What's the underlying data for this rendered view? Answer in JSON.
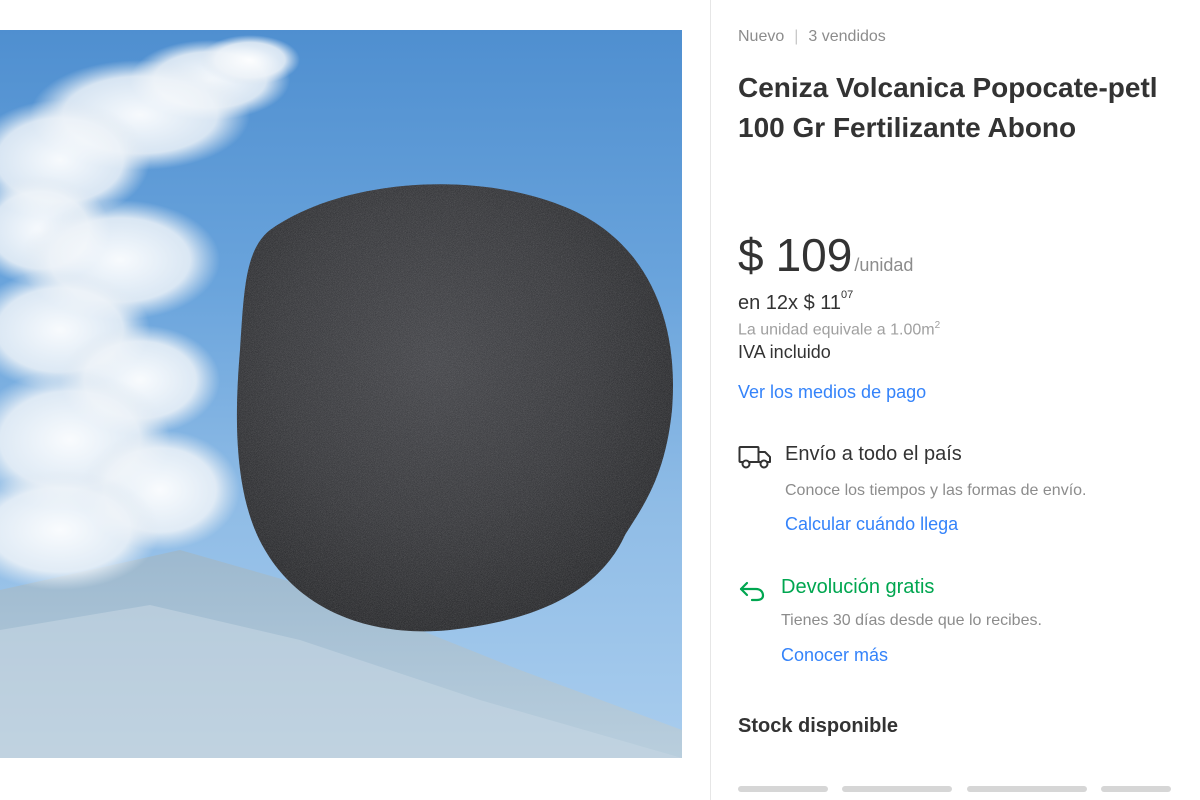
{
  "product": {
    "condition": "Nuevo",
    "separator": "|",
    "sold": "3 vendidos",
    "title": "Ceniza Volcanica Popocate-petl 100 Gr Fertilizante Abono",
    "image_alt": "volcanic-ash-product-photo"
  },
  "price": {
    "symbol": "$",
    "amount": "109",
    "unit": "/unidad",
    "installments_prefix": "en 12x $ 11",
    "installments_cents": "07",
    "equivalence_text": "La unidad equivale a 1.00m",
    "equivalence_sup": "2",
    "tax_note": "IVA incluido",
    "payment_link": "Ver los medios de pago"
  },
  "shipping": {
    "icon": "truck-icon",
    "title": "Envío a todo el país",
    "description": "Conoce los tiempos y las formas de envío.",
    "link": "Calcular cuándo llega"
  },
  "returns": {
    "icon": "return-arrow-icon",
    "title": "Devolución gratis",
    "description": "Tienes 30 días desde que lo recibes.",
    "link": "Conocer más",
    "accent_color": "#00a650"
  },
  "stock": {
    "label": "Stock disponible"
  },
  "theme": {
    "link_color": "#3483fa",
    "text_color": "#333333",
    "muted_color": "#8c8c8c"
  }
}
